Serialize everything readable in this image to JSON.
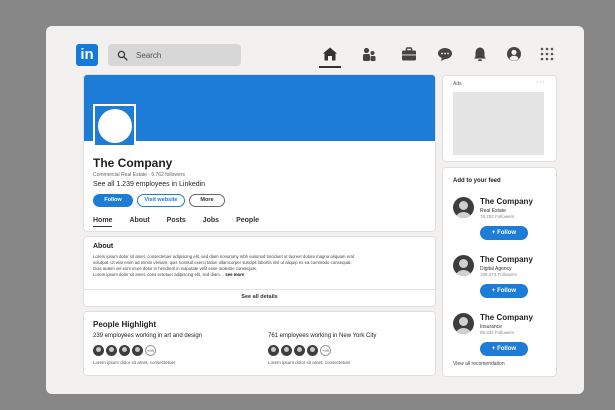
{
  "nav": {
    "logo": "in",
    "search_placeholder": "Search",
    "icons": [
      "home-icon",
      "people-icon",
      "briefcase-icon",
      "chat-icon",
      "bell-icon",
      "profile-icon",
      "grid-icon"
    ]
  },
  "profile": {
    "name": "The Company",
    "subtitle": "Commercial Real Estate · 6.762 followers",
    "employees": "See all 1.239 employees in Linkedin",
    "follow_label": "Follow",
    "visit_label": "Visit website",
    "more_label": "More",
    "tabs": [
      "Home",
      "About",
      "Posts",
      "Jobs",
      "People"
    ]
  },
  "about": {
    "title": "About",
    "line1": "Lorem ipsum dolor sit amet, consectetuer adipiscing elit, sed diam nonummy nibh euismod tincidunt ut laoreet dolore magna aliquam erat",
    "line2": "volutpat. Ut wisi enim ad minim veniam, quis nostrud exerci tation ullamcorper suscipit lobortis nisl ut aliquip ex ea commodo consequat.",
    "line3": "Duis autem vel eum iriure dolor in hendrerit in vulputate velit esse molestie consequat.",
    "line4": "Lorem ipsum dolor sit amet, cons ectetuer adipiscing elit, sed diam…",
    "see_more": "see more",
    "see_all": "See all details"
  },
  "people": {
    "title": "People Highlight",
    "col1_head": "239 employees working in art and design",
    "col1_caption": "Lorem ipsum dolor sit amet, consectetuer",
    "col2_head": "761 employees working in New York City",
    "col2_caption": "Lorem ipsum dolor sit amet, consectetuer",
    "more_badge": "+99"
  },
  "ads": {
    "label": "Ads",
    "menu": "···"
  },
  "feed": {
    "title": "Add to your feed",
    "items": [
      {
        "name": "The Company",
        "type": "Real Estate",
        "followers": "78.292 Followers",
        "button": "+ Follow"
      },
      {
        "name": "The Company",
        "type": "Digital Agency",
        "followers": "108.273 Followers",
        "button": "+ Follow"
      },
      {
        "name": "The Company",
        "type": "Insurance",
        "followers": "89.332 Followers",
        "button": "+ Follow"
      }
    ],
    "view_all": "View all recomendation"
  },
  "colors": {
    "accent": "#1c7cd6",
    "background": "#878787",
    "frame": "#f2f1ef"
  }
}
